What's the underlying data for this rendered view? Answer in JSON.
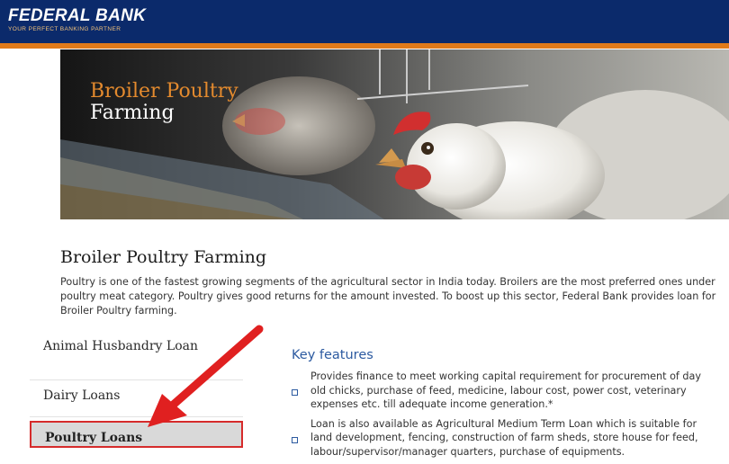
{
  "header": {
    "logo_text": "FEDERAL BANK",
    "tagline": "YOUR PERFECT BANKING PARTNER"
  },
  "banner": {
    "title_line1": "Broiler Poultry",
    "title_line2": "Farming"
  },
  "page": {
    "title": "Broiler Poultry Farming",
    "intro": "Poultry is one of the fastest growing segments of the agricultural sector in India today. Broilers are the most preferred ones under poultry meat category. Poultry gives good returns for the amount invested. To boost up this sector, Federal Bank provides loan for Broiler Poultry farming."
  },
  "sidebar": {
    "items": [
      {
        "label": "Animal Husbandry Loan"
      },
      {
        "label": "Dairy Loans"
      },
      {
        "label": "Poultry Loans"
      }
    ]
  },
  "key_features": {
    "title": "Key features",
    "items": [
      "Provides finance to meet working capital requirement for procurement of day old chicks, purchase of feed, medicine, labour cost, power cost, veterinary expenses etc. till adequate income generation.*",
      "Loan is also available as Agricultural Medium Term Loan which is suitable for land development, fencing, construction of farm sheds, store house for  feed, labour/supervisor/manager quarters, purchase of equipments."
    ]
  },
  "colors": {
    "header_bg": "#0b2a6b",
    "accent_orange": "#e07a1a",
    "link_blue": "#2c5aa0",
    "highlight_red": "#d62b2b"
  }
}
